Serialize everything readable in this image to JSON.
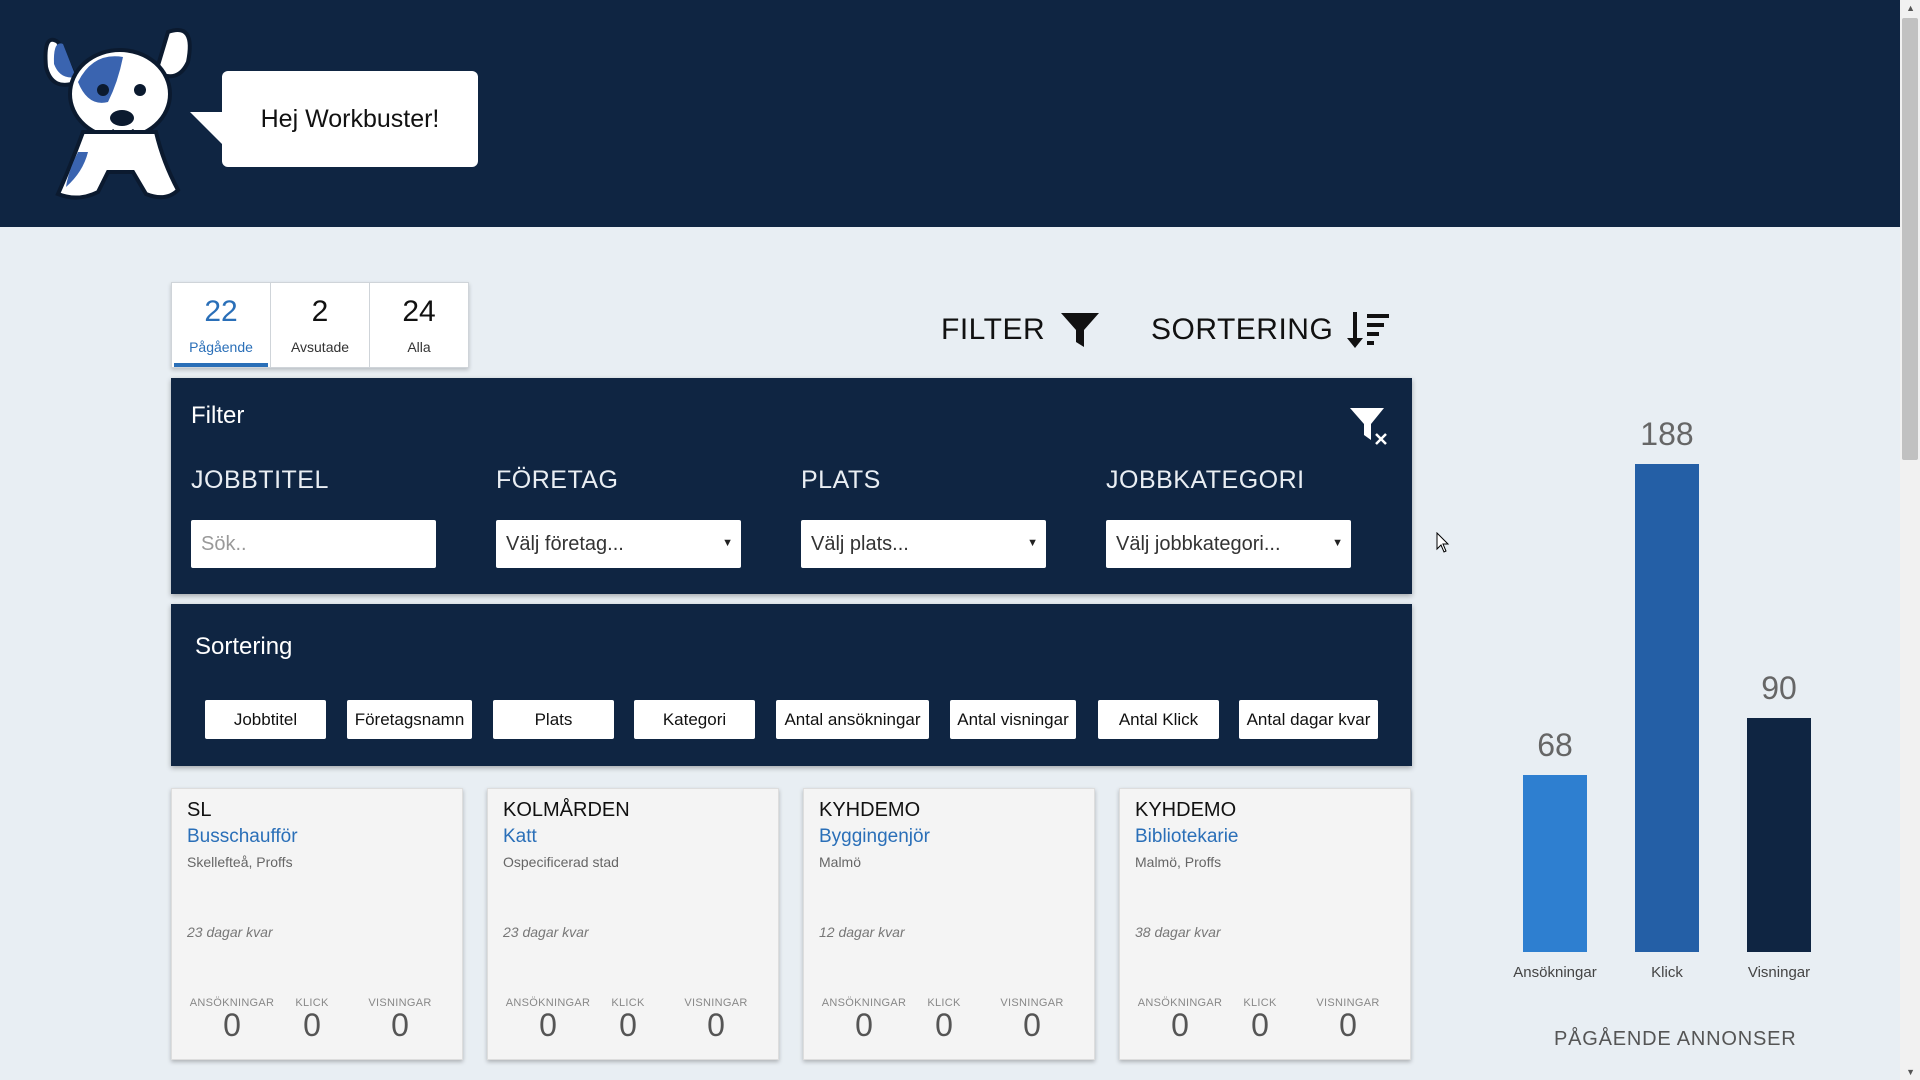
{
  "header": {
    "greeting": "Hej Workbuster!"
  },
  "tabs": [
    {
      "count": "22",
      "label": "Pågående",
      "active": true
    },
    {
      "count": "2",
      "label": "Avsutade",
      "active": false
    },
    {
      "count": "24",
      "label": "Alla",
      "active": false
    }
  ],
  "toolbar": {
    "filter_label": "FILTER",
    "sort_label": "SORTERING"
  },
  "filter": {
    "title": "Filter",
    "fields": [
      {
        "label": "JOBBTITEL",
        "placeholder": "Sök..",
        "type": "text"
      },
      {
        "label": "FÖRETAG",
        "value": "Välj företag...",
        "type": "select"
      },
      {
        "label": "PLATS",
        "value": "Välj plats...",
        "type": "select"
      },
      {
        "label": "JOBBKATEGORI",
        "value": "Välj jobbkategori...",
        "type": "select"
      }
    ]
  },
  "sort": {
    "title": "Sortering",
    "buttons": [
      "Jobbtitel",
      "Företagsnamn",
      "Plats",
      "Kategori",
      "Antal ansökningar",
      "Antal visningar",
      "Antal Klick",
      "Antal dagar kvar"
    ]
  },
  "cards": [
    {
      "company": "SL",
      "title": "Busschaufför",
      "location": "Skellefteå, Proffs",
      "days": "23 dagar kvar",
      "applications": "0",
      "clicks": "0",
      "views": "0"
    },
    {
      "company": "KOLMÅRDEN",
      "title": "Katt",
      "location": "Ospecificerad stad",
      "days": "23 dagar kvar",
      "applications": "0",
      "clicks": "0",
      "views": "0"
    },
    {
      "company": "KYHDEMO",
      "title": "Byggingenjör",
      "location": "Malmö",
      "days": "12 dagar kvar",
      "applications": "0",
      "clicks": "0",
      "views": "0"
    },
    {
      "company": "KYHDEMO",
      "title": "Bibliotekarie",
      "location": "Malmö, Proffs",
      "days": "38 dagar kvar",
      "applications": "0",
      "clicks": "0",
      "views": "0"
    }
  ],
  "stat_labels": {
    "applications": "ANSÖKNINGAR",
    "clicks": "KLICK",
    "views": "VISNINGAR"
  },
  "chart_data": {
    "type": "bar",
    "categories": [
      "Ansökningar",
      "Klick",
      "Visningar"
    ],
    "values": [
      68,
      188,
      90
    ],
    "colors": [
      "#2e7fd0",
      "#245fa6",
      "#0f2542"
    ],
    "title": "PÅGÅENDE ANNONSER",
    "xlabel": "",
    "ylabel": "",
    "grid": false
  },
  "colors": {
    "navy": "#0f2542",
    "accent": "#2a6fb8",
    "background": "#e8eef3"
  }
}
